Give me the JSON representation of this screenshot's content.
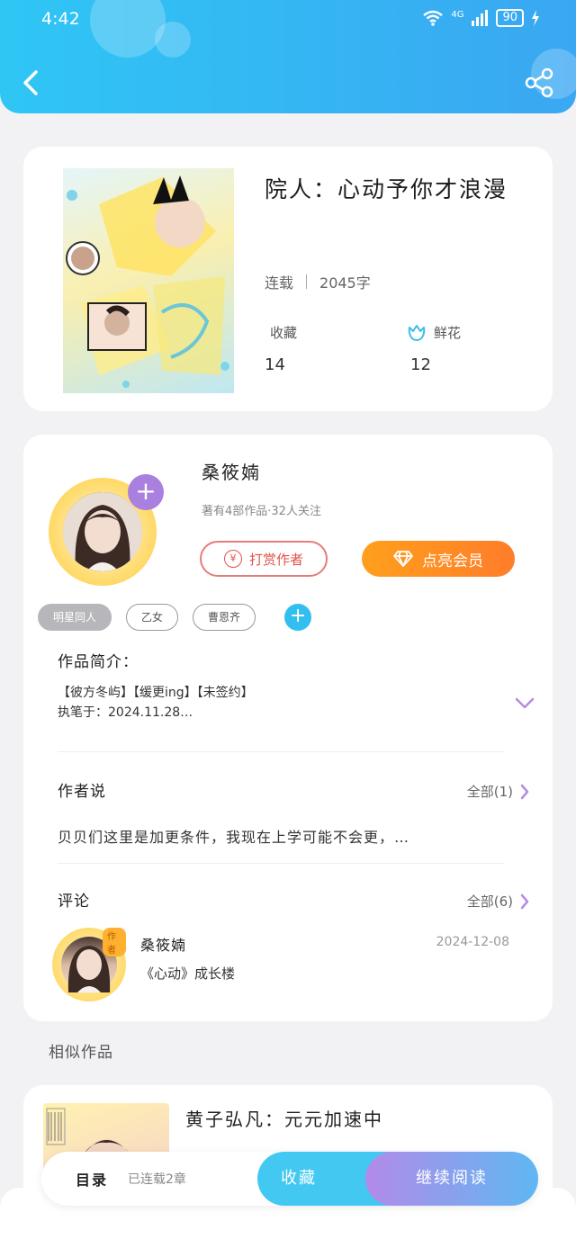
{
  "status_bar": {
    "time": "4:42",
    "network": "4G",
    "battery": "90"
  },
  "book": {
    "title": "院人：心动予你才浪漫",
    "status": "连载",
    "word_count": "2045字",
    "favorites_label": "收藏",
    "favorites_value": "14",
    "flowers_label": "鲜花",
    "flowers_value": "12"
  },
  "author": {
    "name": "桑筱婻",
    "info": "著有4部作品·32人关注",
    "tip_button": "打赏作者",
    "tip_icon": "¥",
    "vip_button": "点亮会员",
    "tags": [
      "明星同人",
      "乙女",
      "曹恩齐"
    ]
  },
  "intro": {
    "label": "作品简介：",
    "line1": "【彼方冬屿】【缓更ing】【未签约】",
    "line2": "执笔于：2024.11.28…"
  },
  "author_says": {
    "label": "作者说",
    "more": "全部(1)",
    "text": "贝贝们这里是加更条件，我现在上学可能不会更，…"
  },
  "comments": {
    "label": "评论",
    "more": "全部(6)",
    "items": [
      {
        "badge": "作者",
        "name": "桑筱婻",
        "date": "2024-12-08",
        "text": "《心动》成长楼"
      }
    ]
  },
  "similar": {
    "label": "相似作品",
    "items": [
      {
        "title": "黄子弘凡：元元加速中"
      }
    ]
  },
  "bottom_bar": {
    "toc": "目录",
    "chapters": "已连载2章",
    "favorite": "收藏",
    "continue_reading": "继续阅读"
  }
}
